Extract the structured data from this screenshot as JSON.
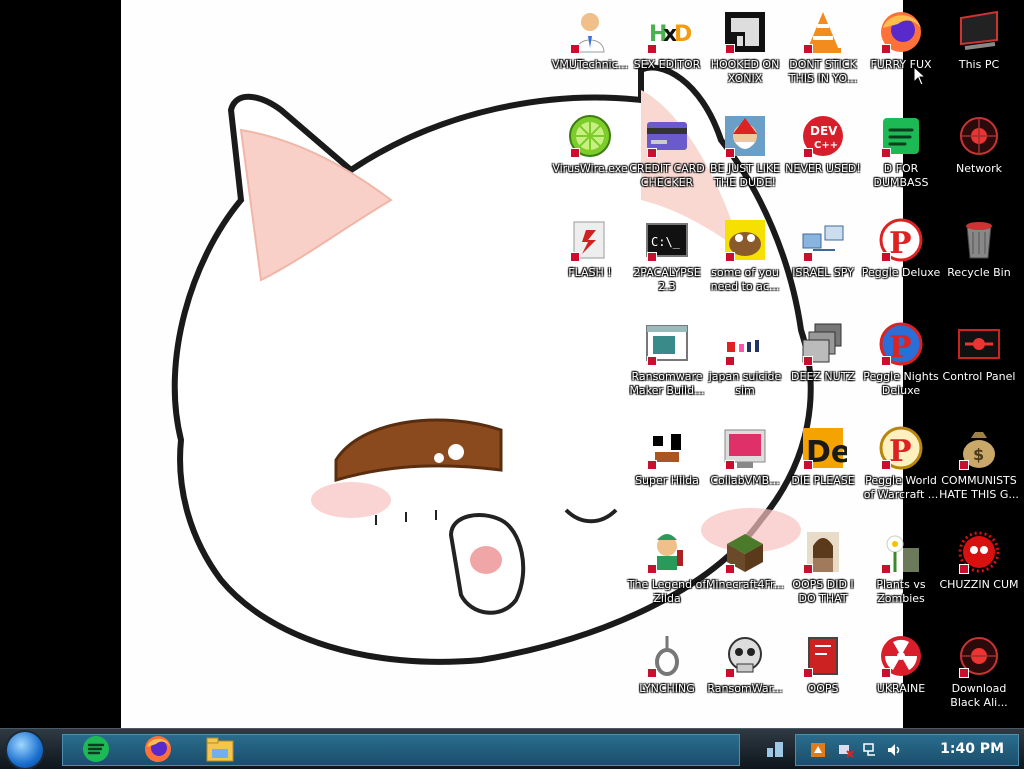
{
  "desktop": {
    "icons": [
      {
        "label": "VMUTechnic...",
        "icon": "user-doctor-icon"
      },
      {
        "label": "SEX EDITOR",
        "icon": "hxd-editor-icon"
      },
      {
        "label": "HOOKED ON XONIX",
        "icon": "xonix-game-icon"
      },
      {
        "label": "DONT STICK THIS IN YO...",
        "icon": "vlc-cone-icon"
      },
      {
        "label": "FURRY FUX",
        "icon": "firefox-icon"
      },
      {
        "label": "This PC",
        "icon": "computer-icon"
      },
      {
        "label": "VirusWire.exe",
        "icon": "lime-icon"
      },
      {
        "label": "CREDIT CARD CHECKER",
        "icon": "credit-card-icon"
      },
      {
        "label": "BE JUST LIKE THE DUDE!",
        "icon": "santa-game-icon"
      },
      {
        "label": "NEVER USED!",
        "icon": "dev-cpp-icon"
      },
      {
        "label": "D FOR DUMBASS",
        "icon": "document-green-icon"
      },
      {
        "label": "Network",
        "icon": "network-icon"
      },
      {
        "label": "FLASH !",
        "icon": "flash-icon"
      },
      {
        "label": "2PACALYPSE 2.3",
        "icon": "terminal-icon"
      },
      {
        "label": "some of you need to ac...",
        "icon": "scooby-icon"
      },
      {
        "label": "ISRAEL SPY",
        "icon": "network-spy-icon"
      },
      {
        "label": "Peggle Deluxe",
        "icon": "peggle-icon"
      },
      {
        "label": "Recycle Bin",
        "icon": "recycle-bin-icon"
      },
      {
        "label": "Ransomware Maker Build...",
        "icon": "window-app-icon"
      },
      {
        "label": "japan suicide sim",
        "icon": "japan-sim-icon"
      },
      {
        "label": "DEEZ NUTZ",
        "icon": "stacked-windows-icon"
      },
      {
        "label": "Peggle Nights Deluxe",
        "icon": "peggle-nights-icon"
      },
      {
        "label": "Control Panel",
        "icon": "control-panel-icon"
      },
      {
        "label": "Super Hilda",
        "icon": "pixel-game-icon"
      },
      {
        "label": "CollabVMB...",
        "icon": "collabvm-icon"
      },
      {
        "label": "DIE PLEASE",
        "icon": "de-letters-icon"
      },
      {
        "label": "Peggle World of Warcraft ...",
        "icon": "peggle-wow-icon"
      },
      {
        "label": "COMMUNISTS HATE THIS G...",
        "icon": "money-bag-icon"
      },
      {
        "label": "The Legend of Zilda",
        "icon": "zilda-hero-icon"
      },
      {
        "label": "Minecraft4Fr...",
        "icon": "grass-block-icon"
      },
      {
        "label": "OOPS DID I DO THAT",
        "icon": "portrait-icon"
      },
      {
        "label": "Plants vs Zombies",
        "icon": "pvz-icon"
      },
      {
        "label": "CHUZZIN CUM",
        "icon": "chuzzle-icon"
      },
      {
        "label": "LYNCHING",
        "icon": "noose-icon"
      },
      {
        "label": "RansomWar...",
        "icon": "skull-icon"
      },
      {
        "label": "OOPS",
        "icon": "red-box-icon"
      },
      {
        "label": "UKRAINE",
        "icon": "radiation-icon"
      },
      {
        "label": "Download Black Ali...",
        "icon": "black-alien-icon"
      }
    ]
  },
  "taskbar": {
    "pinned": [
      "spotify-icon",
      "firefox-icon",
      "file-explorer-icon"
    ],
    "tray_icons": [
      "app-tray-icon",
      "network-error-icon",
      "network-icon",
      "volume-icon"
    ],
    "clock": "1:40 PM"
  }
}
